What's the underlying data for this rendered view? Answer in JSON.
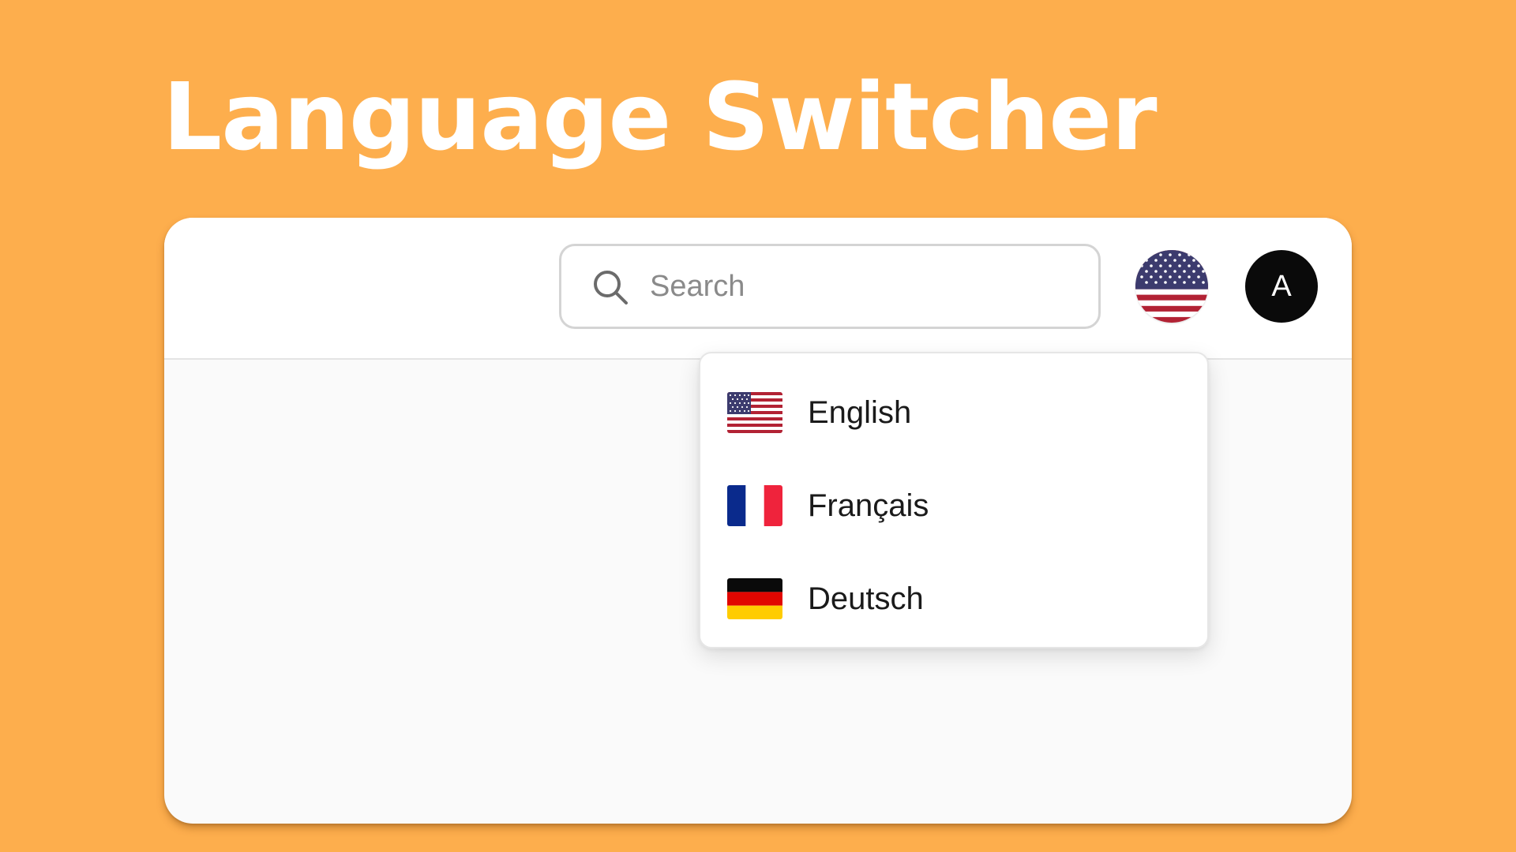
{
  "page": {
    "title": "Language Switcher",
    "background_color": "#FDAE4D"
  },
  "topbar": {
    "search": {
      "placeholder": "Search",
      "value": "",
      "icon": "search-icon"
    },
    "language_toggle": {
      "current": "English",
      "icon": "us-flag-icon"
    },
    "avatar": {
      "initial": "A"
    }
  },
  "language_menu": {
    "open": true,
    "items": [
      {
        "label": "English",
        "icon": "us-flag-icon"
      },
      {
        "label": "Français",
        "icon": "fr-flag-icon"
      },
      {
        "label": "Deutsch",
        "icon": "de-flag-icon"
      }
    ]
  }
}
